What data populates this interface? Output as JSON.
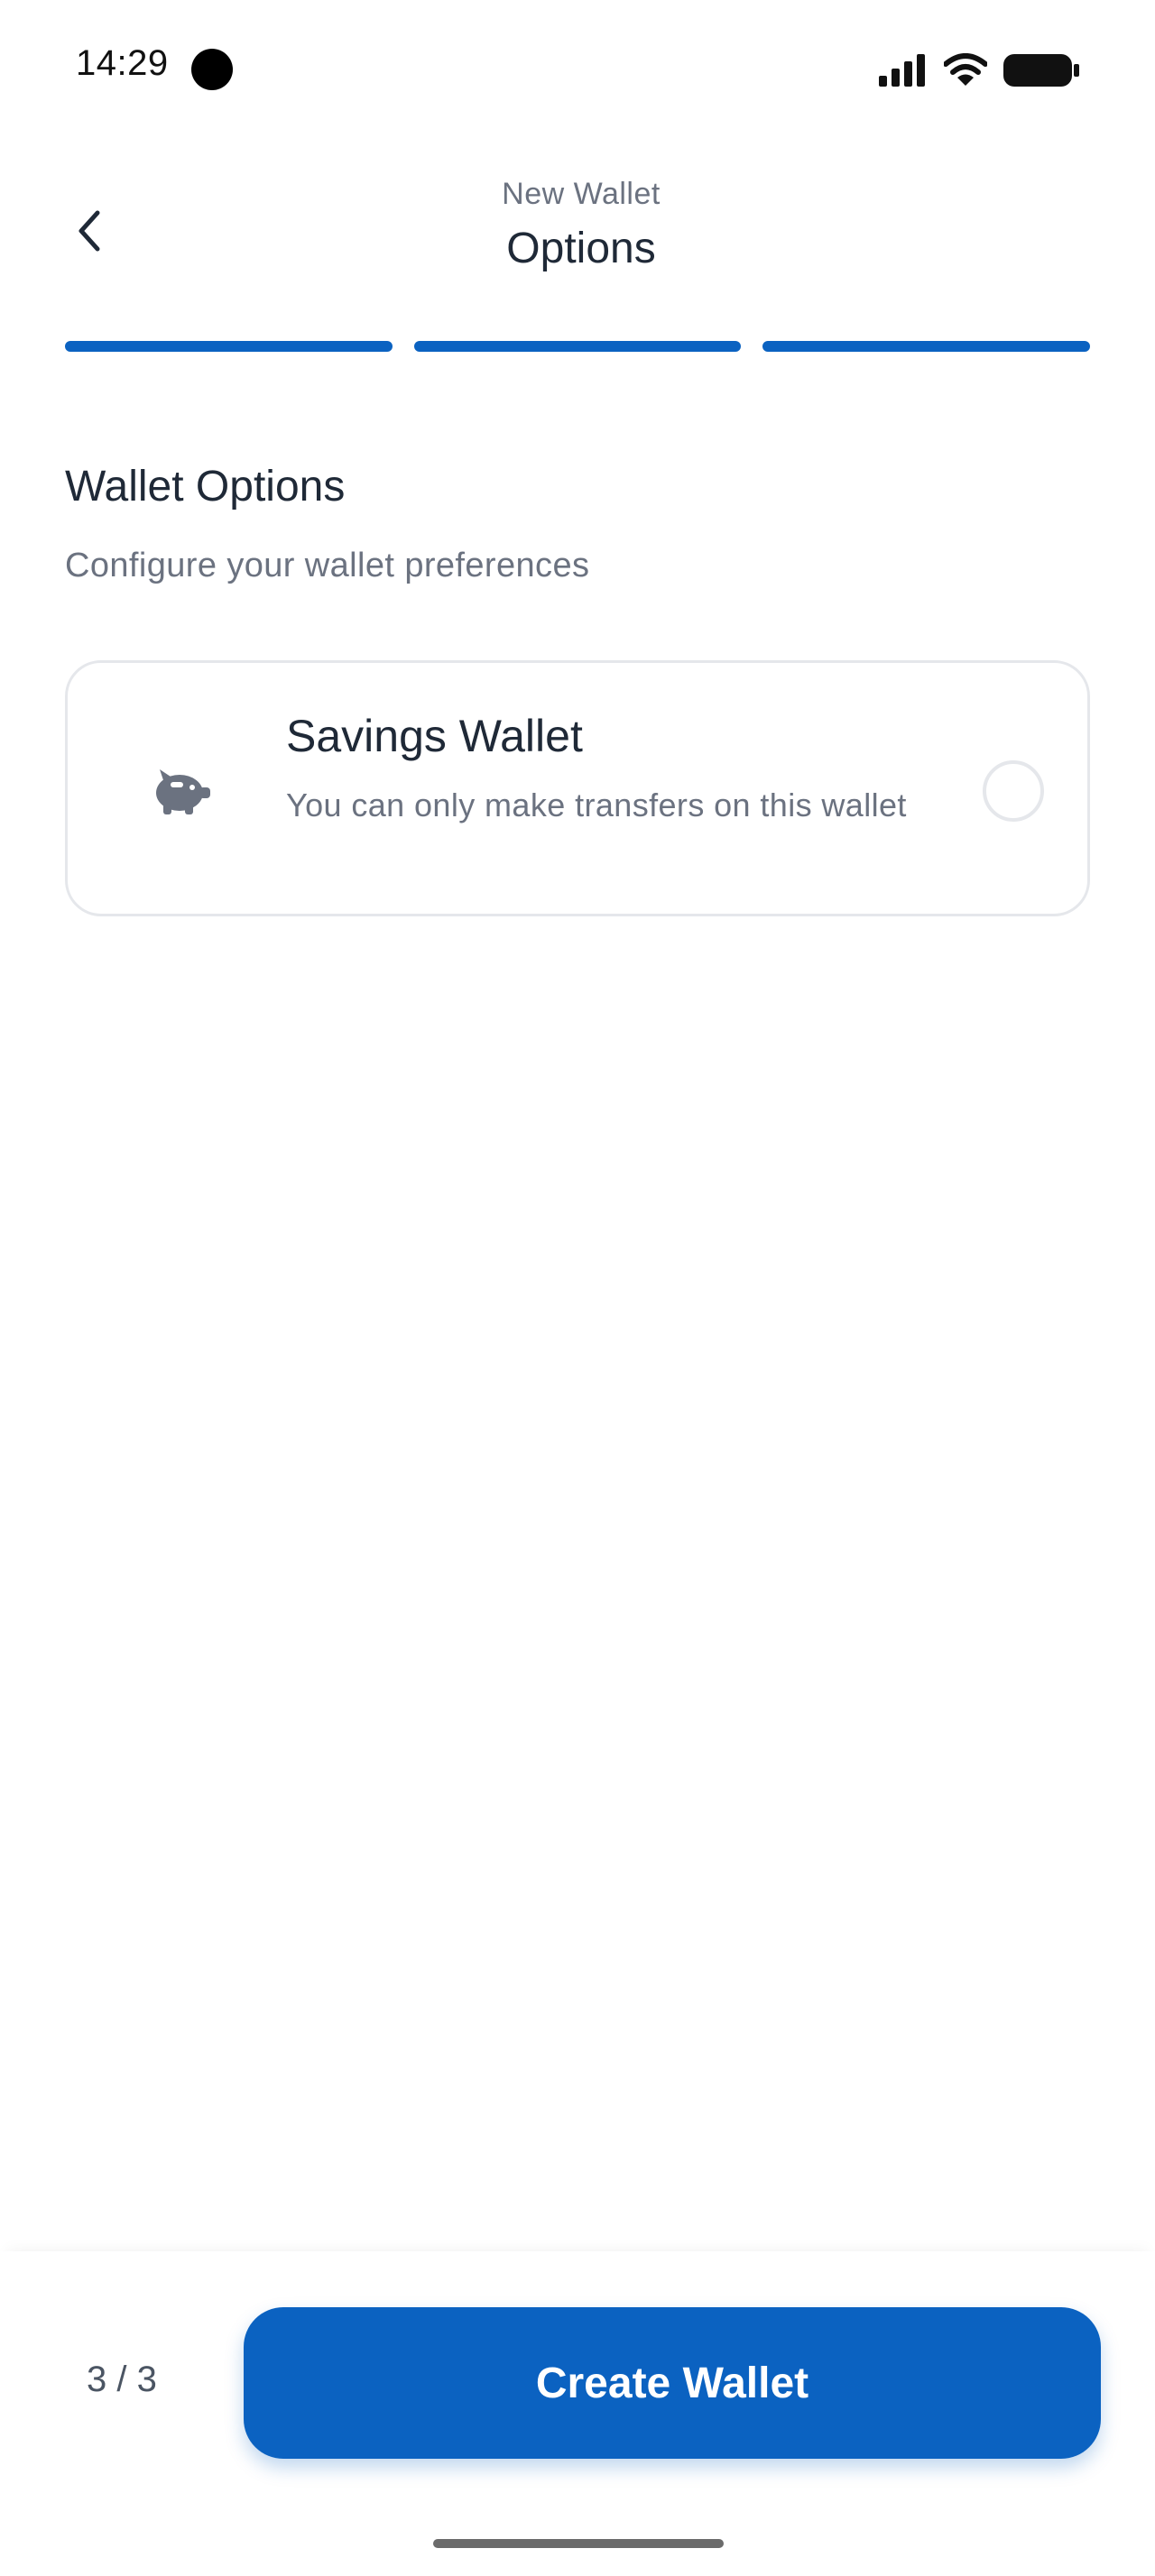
{
  "status_bar": {
    "time": "14:29",
    "icons": [
      "signal-icon",
      "wifi-icon",
      "battery-icon"
    ]
  },
  "header": {
    "subtitle": "New Wallet",
    "title": "Options",
    "back_icon": "chevron-left-icon"
  },
  "progress": {
    "total_steps": 3,
    "completed_steps": 3,
    "active_color": "#0b62c1"
  },
  "section": {
    "title": "Wallet Options",
    "description": "Configure your wallet preferences"
  },
  "options": [
    {
      "title": "Savings Wallet",
      "description": "You can only make transfers on this wallet",
      "icon": "piggy-bank-icon",
      "selected": false
    }
  ],
  "footer": {
    "step_counter": "3 / 3",
    "create_button_label": "Create Wallet",
    "button_color": "#0b62c1"
  }
}
